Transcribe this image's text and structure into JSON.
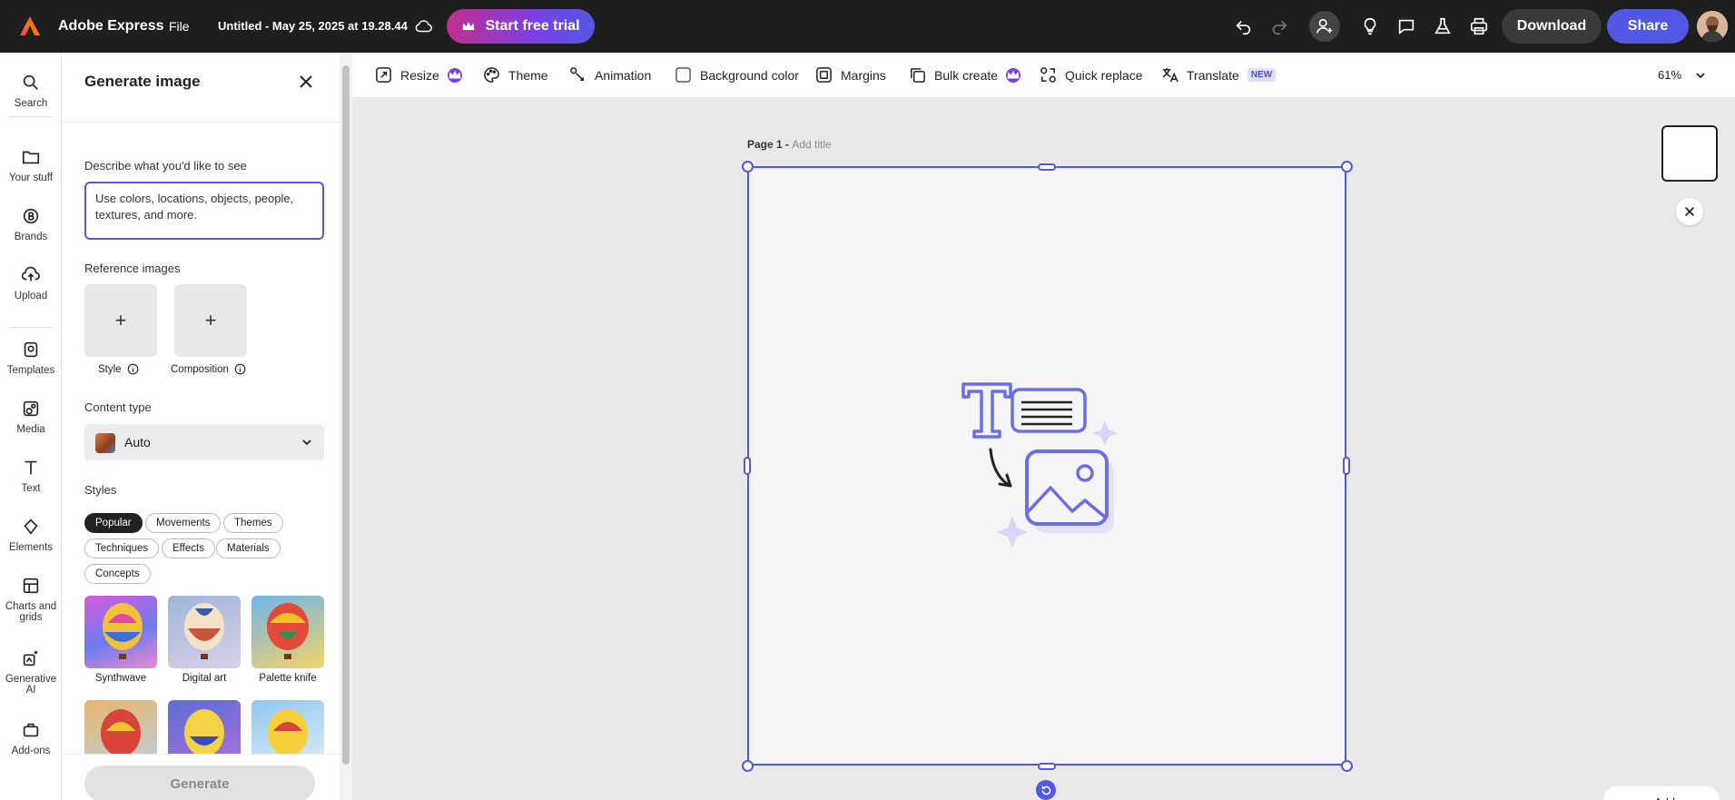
{
  "header": {
    "app_name": "Adobe Express",
    "file_menu": "File",
    "doc_title": "Untitled - May 25, 2025 at 19.28.44",
    "trial_button": "Start free trial",
    "download": "Download",
    "share": "Share",
    "icons": [
      "undo-icon",
      "redo-icon",
      "invite-icon",
      "lightbulb-icon",
      "comment-icon",
      "flask-icon",
      "print-icon"
    ]
  },
  "rail": {
    "items": [
      {
        "label": "Search",
        "icon": "search-icon"
      },
      {
        "label": "Your stuff",
        "icon": "folder-icon"
      },
      {
        "label": "Brands",
        "icon": "brand-icon"
      },
      {
        "label": "Upload",
        "icon": "upload-icon"
      },
      {
        "label": "Templates",
        "icon": "templates-icon"
      },
      {
        "label": "Media",
        "icon": "media-icon"
      },
      {
        "label": "Text",
        "icon": "text-icon"
      },
      {
        "label": "Elements",
        "icon": "elements-icon"
      },
      {
        "label_line1": "Charts and",
        "label_line2": "grids",
        "icon": "chart-icon"
      },
      {
        "label_line1": "Generative",
        "label_line2": "AI",
        "icon": "generative-ai-icon"
      },
      {
        "label": "Add-ons",
        "icon": "addons-icon"
      }
    ]
  },
  "panel": {
    "title": "Generate image",
    "describe_label": "Describe what you'd like to see",
    "prompt_placeholder": "Use colors, locations, objects, people, textures, and more.",
    "reference_label": "Reference images",
    "style_caption": "Style",
    "composition_caption": "Composition",
    "content_type_label": "Content type",
    "content_type_value": "Auto",
    "styles_label": "Styles",
    "style_chips": [
      "Popular",
      "Movements",
      "Themes",
      "Techniques",
      "Effects",
      "Materials",
      "Concepts"
    ],
    "style_tiles": [
      "Synthwave",
      "Digital art",
      "Palette knife"
    ],
    "generate_button": "Generate"
  },
  "toolbar": {
    "resize": "Resize",
    "theme": "Theme",
    "animation": "Animation",
    "background_color": "Background color",
    "margins": "Margins",
    "bulk_create": "Bulk create",
    "quick_replace": "Quick replace",
    "translate": "Translate",
    "new_badge": "NEW",
    "zoom": "61%"
  },
  "canvas": {
    "page_label": "Page 1 -",
    "add_title": "Add title",
    "add_page": "Add page"
  },
  "colors": {
    "accent": "#5258e4",
    "topbar": "#1e1e1e",
    "premium": "#7b3fe4"
  }
}
